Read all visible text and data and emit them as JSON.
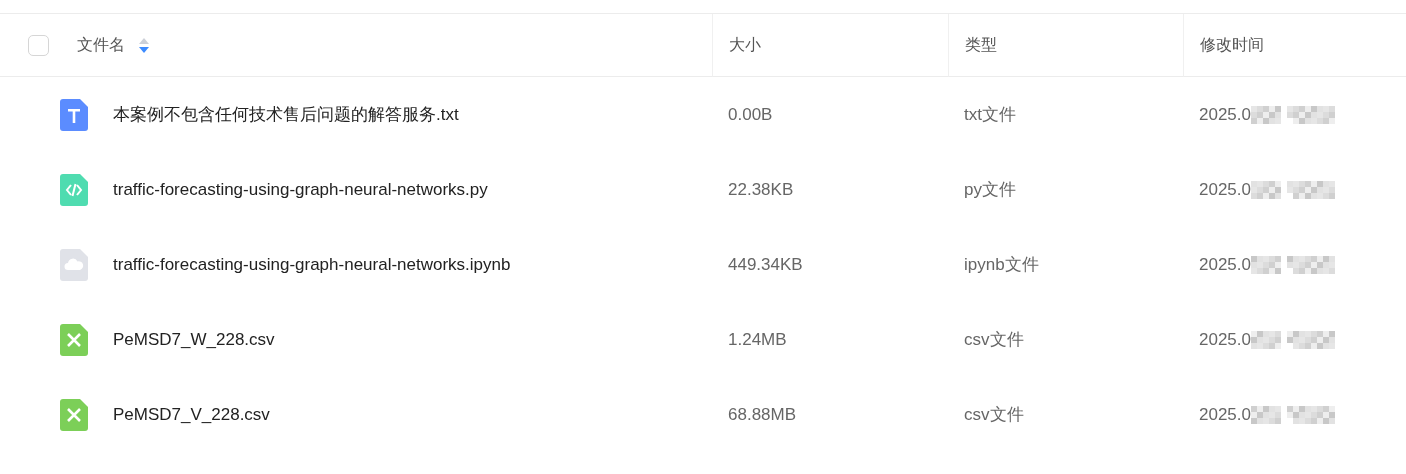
{
  "table": {
    "select_all": {
      "checked": false
    },
    "columns": [
      {
        "label": "文件名",
        "sort_descending": true
      },
      {
        "label": "大小"
      },
      {
        "label": "类型"
      },
      {
        "label": "修改时间"
      }
    ],
    "rows": [
      {
        "kind": "text",
        "name": "本案例不包含任何技术售后问题的解答服务.txt",
        "size": "0.00B",
        "type": "txt文件",
        "modified": "2025.0"
      },
      {
        "kind": "code",
        "name": "traffic-forecasting-using-graph-neural-networks.py",
        "size": "22.38KB",
        "type": "py文件",
        "modified": "2025.0"
      },
      {
        "kind": "cloud",
        "name": "traffic-forecasting-using-graph-neural-networks.ipynb",
        "size": "449.34KB",
        "type": "ipynb文件",
        "modified": "2025.0"
      },
      {
        "kind": "sheet",
        "name": "PeMSD7_W_228.csv",
        "size": "1.24MB",
        "type": "csv文件",
        "modified": "2025.0"
      },
      {
        "kind": "sheet",
        "name": "PeMSD7_V_228.csv",
        "size": "68.88MB",
        "type": "csv文件",
        "modified": "2025.0"
      }
    ]
  }
}
